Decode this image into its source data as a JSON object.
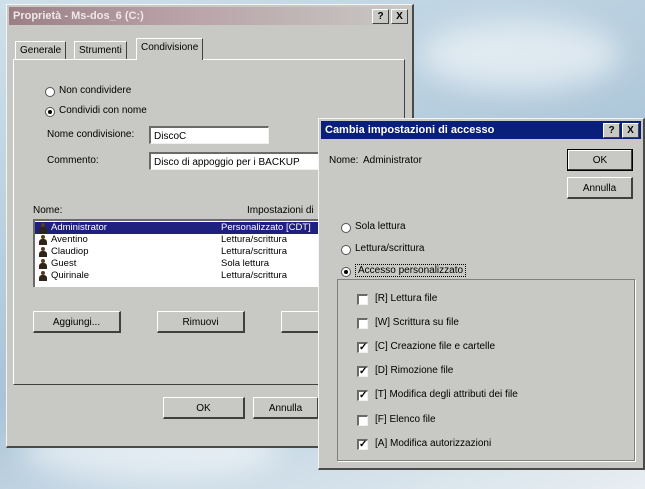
{
  "colors": {
    "title_active": "#0a1f7a",
    "title_inactive": "#8b8fa0",
    "selection": "#1f1f7f"
  },
  "back_window": {
    "title": "Proprietà - Ms-dos_6 (C:)",
    "title_buttons": [
      "?",
      "X"
    ],
    "tabs": [
      "Generale",
      "Strumenti",
      "Condivisione"
    ],
    "radio_non_condividere": "Non condividere",
    "radio_condividi": "Condividi con nome",
    "share_name_label": "Nome condivisione:",
    "share_name_value": "DiscoC",
    "comment_label": "Commento:",
    "comment_value": "Disco di appoggio per i BACKUP",
    "list_header_name": "Nome:",
    "list_header_perm": "Impostazioni di",
    "users": [
      {
        "name": "Administrator",
        "perm": "Personalizzato [CDT]"
      },
      {
        "name": "Aventino",
        "perm": "Lettura/scrittura"
      },
      {
        "name": "Claudiop",
        "perm": "Lettura/scrittura"
      },
      {
        "name": "Guest",
        "perm": "Sola lettura"
      },
      {
        "name": "Quirinale",
        "perm": "Lettura/scrittura"
      }
    ],
    "btn_add": "Aggiungi...",
    "btn_remove": "Rimuovi",
    "btn_modify": "Mo",
    "btn_ok": "OK",
    "btn_cancel": "Annulla"
  },
  "dialog": {
    "title": "Cambia impostazioni di accesso",
    "title_buttons": [
      "?",
      "X"
    ],
    "name_label": "Nome:",
    "name_value": "Administrator",
    "btn_ok": "OK",
    "btn_cancel": "Annulla",
    "radio_read_only": "Sola lettura",
    "radio_read_write": "Lettura/scrittura",
    "radio_custom": "Accesso personalizzato",
    "permissions": [
      {
        "label": "[R] Lettura file",
        "checked": false,
        "mark": ""
      },
      {
        "label": "[W] Scrittura su file",
        "checked": false,
        "mark": ""
      },
      {
        "label": "[C] Creazione file e cartelle",
        "checked": true,
        "mark": "✓"
      },
      {
        "label": "[D] Rimozione file",
        "checked": true,
        "mark": "✓"
      },
      {
        "label": "[T] Modifica degli attributi dei file",
        "checked": true,
        "mark": "✓"
      },
      {
        "label": "[F] Elenco file",
        "checked": false,
        "mark": ""
      },
      {
        "label": "[A] Modifica autorizzazioni",
        "checked": true,
        "mark": "✓"
      }
    ]
  }
}
